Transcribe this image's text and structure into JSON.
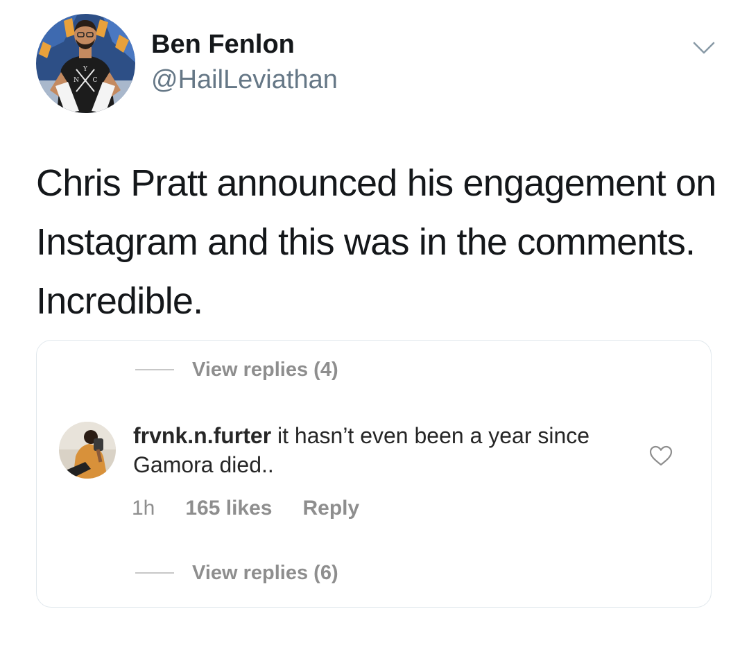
{
  "tweet": {
    "author": {
      "display_name": "Ben Fenlon",
      "handle": "@HailLeviathan",
      "avatar_icon": "profile-photo",
      "shirt_text": "N Y C"
    },
    "menu_icon": "chevron-down-icon",
    "text": "Chris Pratt announced his engagement on Instagram and this was in the comments. Incredible."
  },
  "embedded_comment": {
    "view_replies_top": "View replies (4)",
    "comment": {
      "username": "frvnk.n.furter",
      "body": " it hasn’t even been a year since Gamora died..",
      "time": "1h",
      "likes": "165 likes",
      "reply_label": "Reply",
      "like_icon": "heart-icon",
      "avatar_icon": "commenter-avatar"
    },
    "view_replies_bottom": "View replies (6)"
  },
  "colors": {
    "primary_text": "#14171a",
    "secondary_text": "#657786",
    "instagram_text": "#262626",
    "instagram_muted": "#8e8e8e",
    "card_border": "#e1e8ed"
  }
}
